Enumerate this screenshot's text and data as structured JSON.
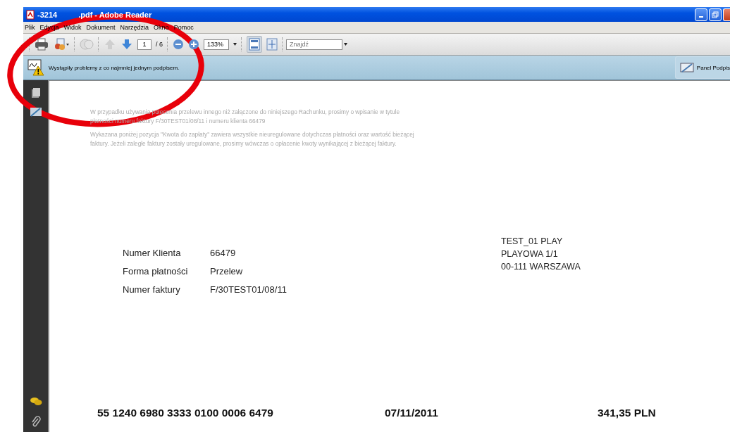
{
  "window": {
    "title_start": "-3214",
    "title_end": ".pdf - Adobe Reader"
  },
  "menu": [
    "Plik",
    "Edycja",
    "Widok",
    "Dokument",
    "Narzędzia",
    "Okno",
    "Pomoc"
  ],
  "toolbar": {
    "page": "1",
    "page_total": "/ 6",
    "zoom": "133%",
    "search_placeholder": "Znajdź"
  },
  "signature_bar": {
    "message": "Wystąpiły problemy z co najmniej jednym podpisem.",
    "panel_button": "Panel Podpis"
  },
  "document": {
    "notes": [
      "W przypadku używania polecenia przelewu innego niż załączone do niniejszego Rachunku, prosimy o wpisanie w tytule płatności numeru faktury F/30TEST01/08/11 i numeru klienta 66479",
      "Wykazana poniżej pozycja \"Kwota do zapłaty\" zawiera wszystkie nieuregulowane dotychczas płatności oraz wartość bieżącej faktury. Jeżeli zaległe faktury zostały uregulowane, prosimy wówczas o opłacenie kwoty wynikającej z bieżącej faktury."
    ],
    "fields": [
      {
        "label": "Numer Klienta",
        "value": "66479"
      },
      {
        "label": "Forma płatności",
        "value": "Przelew"
      },
      {
        "label": "Numer faktury",
        "value": "F/30TEST01/08/11"
      }
    ],
    "address": [
      "TEST_01 PLAY",
      "PLAYOWA 1/1",
      "00-111 WARSZAWA"
    ],
    "footer": {
      "account": "55 1240 6980 3333 0100 0006 6479",
      "date": "07/11/2011",
      "amount": "341,35 PLN"
    }
  }
}
